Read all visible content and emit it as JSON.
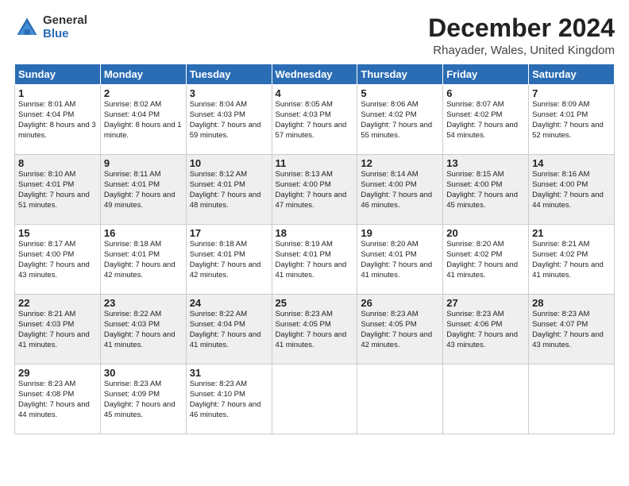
{
  "logo": {
    "general": "General",
    "blue": "Blue"
  },
  "title": "December 2024",
  "subtitle": "Rhayader, Wales, United Kingdom",
  "headers": [
    "Sunday",
    "Monday",
    "Tuesday",
    "Wednesday",
    "Thursday",
    "Friday",
    "Saturday"
  ],
  "weeks": [
    [
      {
        "day": "1",
        "sunrise": "8:01 AM",
        "sunset": "4:04 PM",
        "daylight": "8 hours and 3 minutes."
      },
      {
        "day": "2",
        "sunrise": "8:02 AM",
        "sunset": "4:04 PM",
        "daylight": "8 hours and 1 minute."
      },
      {
        "day": "3",
        "sunrise": "8:04 AM",
        "sunset": "4:03 PM",
        "daylight": "7 hours and 59 minutes."
      },
      {
        "day": "4",
        "sunrise": "8:05 AM",
        "sunset": "4:03 PM",
        "daylight": "7 hours and 57 minutes."
      },
      {
        "day": "5",
        "sunrise": "8:06 AM",
        "sunset": "4:02 PM",
        "daylight": "7 hours and 55 minutes."
      },
      {
        "day": "6",
        "sunrise": "8:07 AM",
        "sunset": "4:02 PM",
        "daylight": "7 hours and 54 minutes."
      },
      {
        "day": "7",
        "sunrise": "8:09 AM",
        "sunset": "4:01 PM",
        "daylight": "7 hours and 52 minutes."
      }
    ],
    [
      {
        "day": "8",
        "sunrise": "8:10 AM",
        "sunset": "4:01 PM",
        "daylight": "7 hours and 51 minutes."
      },
      {
        "day": "9",
        "sunrise": "8:11 AM",
        "sunset": "4:01 PM",
        "daylight": "7 hours and 49 minutes."
      },
      {
        "day": "10",
        "sunrise": "8:12 AM",
        "sunset": "4:01 PM",
        "daylight": "7 hours and 48 minutes."
      },
      {
        "day": "11",
        "sunrise": "8:13 AM",
        "sunset": "4:00 PM",
        "daylight": "7 hours and 47 minutes."
      },
      {
        "day": "12",
        "sunrise": "8:14 AM",
        "sunset": "4:00 PM",
        "daylight": "7 hours and 46 minutes."
      },
      {
        "day": "13",
        "sunrise": "8:15 AM",
        "sunset": "4:00 PM",
        "daylight": "7 hours and 45 minutes."
      },
      {
        "day": "14",
        "sunrise": "8:16 AM",
        "sunset": "4:00 PM",
        "daylight": "7 hours and 44 minutes."
      }
    ],
    [
      {
        "day": "15",
        "sunrise": "8:17 AM",
        "sunset": "4:00 PM",
        "daylight": "7 hours and 43 minutes."
      },
      {
        "day": "16",
        "sunrise": "8:18 AM",
        "sunset": "4:01 PM",
        "daylight": "7 hours and 42 minutes."
      },
      {
        "day": "17",
        "sunrise": "8:18 AM",
        "sunset": "4:01 PM",
        "daylight": "7 hours and 42 minutes."
      },
      {
        "day": "18",
        "sunrise": "8:19 AM",
        "sunset": "4:01 PM",
        "daylight": "7 hours and 41 minutes."
      },
      {
        "day": "19",
        "sunrise": "8:20 AM",
        "sunset": "4:01 PM",
        "daylight": "7 hours and 41 minutes."
      },
      {
        "day": "20",
        "sunrise": "8:20 AM",
        "sunset": "4:02 PM",
        "daylight": "7 hours and 41 minutes."
      },
      {
        "day": "21",
        "sunrise": "8:21 AM",
        "sunset": "4:02 PM",
        "daylight": "7 hours and 41 minutes."
      }
    ],
    [
      {
        "day": "22",
        "sunrise": "8:21 AM",
        "sunset": "4:03 PM",
        "daylight": "7 hours and 41 minutes."
      },
      {
        "day": "23",
        "sunrise": "8:22 AM",
        "sunset": "4:03 PM",
        "daylight": "7 hours and 41 minutes."
      },
      {
        "day": "24",
        "sunrise": "8:22 AM",
        "sunset": "4:04 PM",
        "daylight": "7 hours and 41 minutes."
      },
      {
        "day": "25",
        "sunrise": "8:23 AM",
        "sunset": "4:05 PM",
        "daylight": "7 hours and 41 minutes."
      },
      {
        "day": "26",
        "sunrise": "8:23 AM",
        "sunset": "4:05 PM",
        "daylight": "7 hours and 42 minutes."
      },
      {
        "day": "27",
        "sunrise": "8:23 AM",
        "sunset": "4:06 PM",
        "daylight": "7 hours and 43 minutes."
      },
      {
        "day": "28",
        "sunrise": "8:23 AM",
        "sunset": "4:07 PM",
        "daylight": "7 hours and 43 minutes."
      }
    ],
    [
      {
        "day": "29",
        "sunrise": "8:23 AM",
        "sunset": "4:08 PM",
        "daylight": "7 hours and 44 minutes."
      },
      {
        "day": "30",
        "sunrise": "8:23 AM",
        "sunset": "4:09 PM",
        "daylight": "7 hours and 45 minutes."
      },
      {
        "day": "31",
        "sunrise": "8:23 AM",
        "sunset": "4:10 PM",
        "daylight": "7 hours and 46 minutes."
      },
      null,
      null,
      null,
      null
    ]
  ],
  "labels": {
    "sunrise": "Sunrise: ",
    "sunset": "Sunset: ",
    "daylight": "Daylight: "
  }
}
